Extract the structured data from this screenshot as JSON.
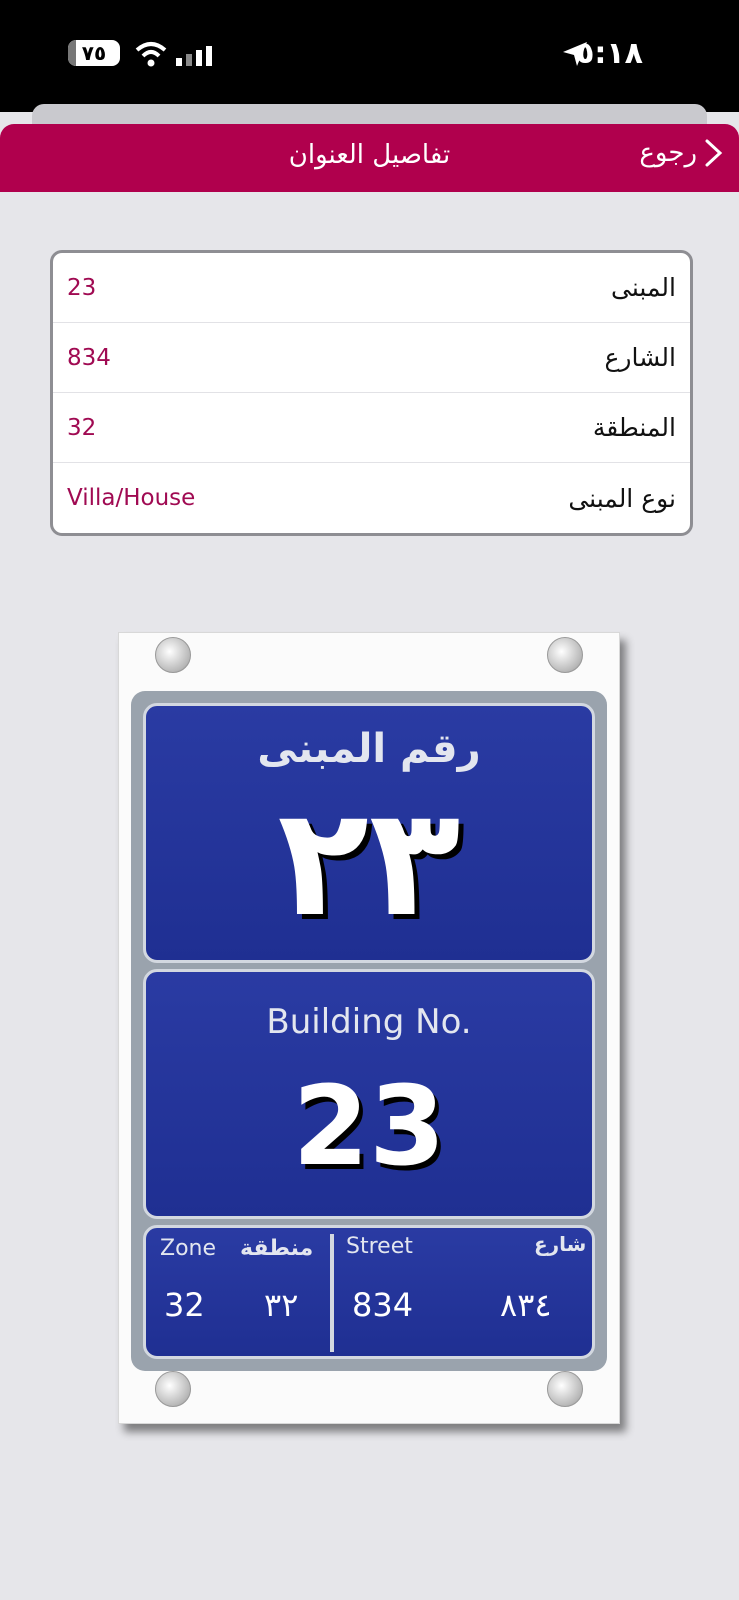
{
  "status_bar": {
    "time": "٥:١٨",
    "battery": "٧٥",
    "icons": [
      "location-arrow-icon",
      "wifi-icon",
      "signal-icon",
      "battery-icon"
    ]
  },
  "nav": {
    "title": "تفاصيل العنوان",
    "back_label": "رجوع"
  },
  "details": [
    {
      "label": "المبنى",
      "value": "23"
    },
    {
      "label": "الشارع",
      "value": "834"
    },
    {
      "label": "المنطقة",
      "value": "32"
    },
    {
      "label": "نوع المبنى",
      "value": "Villa/House"
    }
  ],
  "plate": {
    "ar_heading": "رقم المبنى",
    "ar_number": "٢٣",
    "en_heading": "Building No.",
    "en_number": "23",
    "zone_en": "Zone",
    "zone_ar": "منطقة",
    "zone_num_en": "32",
    "zone_num_ar": "٣٢",
    "street_en": "Street",
    "street_ar": "شارع",
    "street_num_en": "834",
    "street_num_ar": "٨٣٤"
  },
  "colors": {
    "brand": "#b0004d",
    "value_text": "#a00a52",
    "plate_blue": "#2a3ba3"
  }
}
